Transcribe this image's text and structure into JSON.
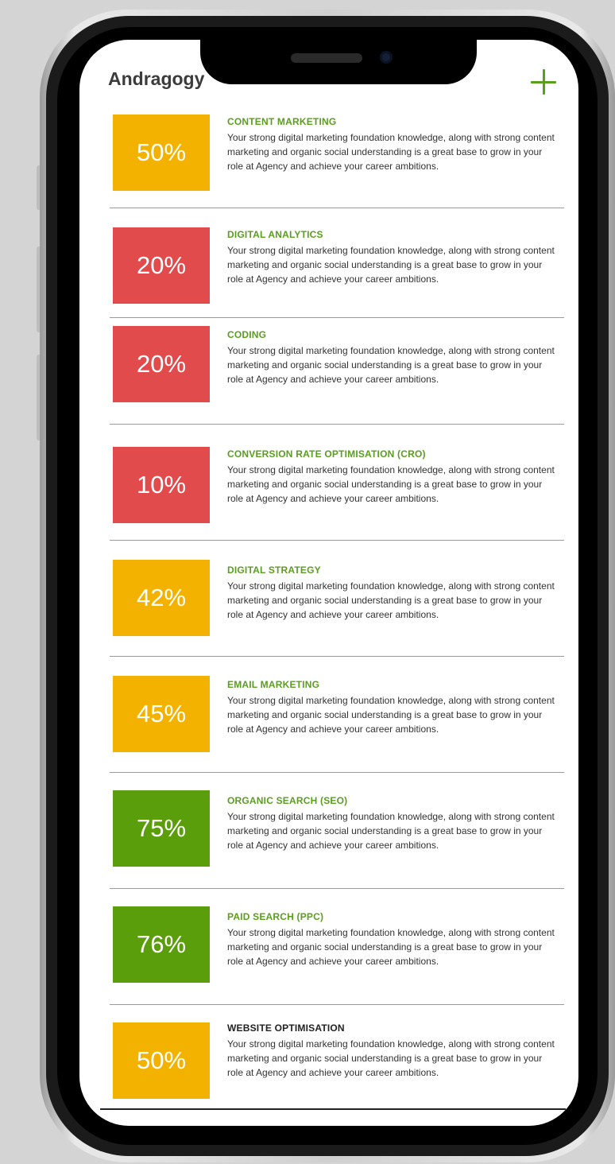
{
  "app": {
    "title": "Andragogy"
  },
  "colors": {
    "amber": "#f4b200",
    "red": "#e14b4b",
    "green": "#5a9e0c",
    "title_green": "#5a9e1e"
  },
  "items": [
    {
      "percent": "50%",
      "name": "CONTENT MARKETING",
      "status": "amber",
      "desc": "Your strong digital marketing foundation knowledge, along with strong content marketing and organic social understanding is a great base to grow in your role at Agency and achieve your career ambitions."
    },
    {
      "percent": "20%",
      "name": "DIGITAL ANALYTICS",
      "status": "red",
      "desc": "Your strong digital marketing foundation knowledge, along with strong content marketing and organic social understanding is a great base to grow in your role at Agency and achieve your career ambitions."
    },
    {
      "percent": "20%",
      "name": "CODING",
      "status": "red",
      "desc": "Your strong digital marketing foundation knowledge, along with strong content marketing and organic social understanding is a great base to grow in your role at Agency and achieve your career ambitions."
    },
    {
      "percent": "10%",
      "name": "CONVERSION RATE OPTIMISATION (CRO)",
      "status": "red",
      "desc": "Your strong digital marketing foundation knowledge, along with strong content marketing and organic social understanding is a great base to grow in your role at Agency and achieve your career ambitions."
    },
    {
      "percent": "42%",
      "name": "DIGITAL STRATEGY",
      "status": "amber",
      "desc": "Your strong digital marketing foundation knowledge, along with strong content marketing and organic social understanding is a great base to grow in your role at Agency and achieve your career ambitions."
    },
    {
      "percent": "45%",
      "name": "EMAIL MARKETING",
      "status": "amber",
      "desc": "Your strong digital marketing foundation knowledge, along with strong content marketing and organic social understanding is a great base to grow in your role at Agency and achieve your career ambitions."
    },
    {
      "percent": "75%",
      "name": "ORGANIC SEARCH (SEO)",
      "status": "green",
      "desc": "Your strong digital marketing foundation knowledge, along with strong content marketing and organic social understanding is a great base to grow in your role at Agency and achieve your career ambitions."
    },
    {
      "percent": "76%",
      "name": "PAID SEARCH (PPC)",
      "status": "green",
      "desc": "Your strong digital marketing foundation knowledge, along with strong content marketing and organic social understanding is a great base to grow in your role at Agency and achieve your career ambitions."
    },
    {
      "percent": "50%",
      "name": "WEBSITE OPTIMISATION",
      "status": "amber",
      "desc": "Your strong digital marketing foundation knowledge, along with strong content marketing and organic social understanding is a great base to grow in your role at Agency and achieve your career ambitions."
    }
  ]
}
